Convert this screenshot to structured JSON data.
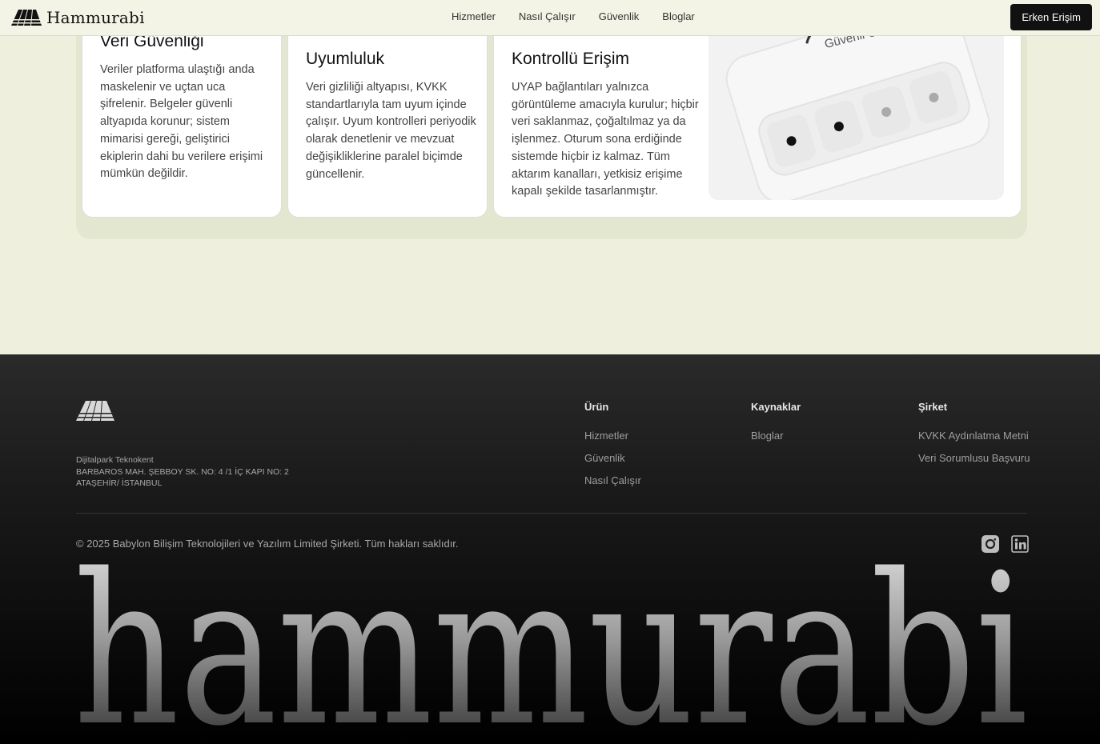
{
  "header": {
    "brand": "Hammurabi",
    "nav": [
      "Hizmetler",
      "Nasıl Çalışır",
      "Güvenlik",
      "Bloglar"
    ],
    "cta": "Erken Erişim"
  },
  "features": [
    {
      "title": "Veri Güvenliği",
      "body": "Veriler platforma ulaştığı anda maskelenir ve uçtan uca şifrelenir. Belgeler güvenli altyapıda korunur; sistem mimarisi gereği, geliştirici ekiplerin dahi bu verilere erişimi mümkün değildir."
    },
    {
      "title": "Uyumluluk",
      "body": "Veri gizliliği altyapısı, KVKK standartlarıyla tam uyum içinde çalışır. Uyum kontrolleri periyodik olarak denetlenir ve mevzuat değişikliklerine paralel biçimde güncellenir."
    },
    {
      "title": "Kontrollü Erişim",
      "body": "UYAP bağlantıları yalnızca görüntüleme amacıyla kurulur; hiçbir veri saklanmaz, çoğaltılmaz ya da işlenmez. Oturum sona erdiğinde sistemde hiçbir iz kalmaz. Tüm aktarım kanalları, yetkisiz erişime kapalı şekilde tasarlanmıştır."
    }
  ],
  "illustration": {
    "caption": "Güvenli Giriş"
  },
  "footer": {
    "address": {
      "line1": "Dijitalpark Teknokent",
      "line2": "BARBAROS MAH. ŞEBBOY SK. NO: 4 /1 İÇ KAPI NO: 2",
      "line3": "ATAŞEHİR/ İSTANBUL"
    },
    "columns": [
      {
        "title": "Ürün",
        "links": [
          "Hizmetler",
          "Güvenlik",
          "Nasıl Çalışır"
        ]
      },
      {
        "title": "Kaynaklar",
        "links": [
          "Bloglar"
        ]
      },
      {
        "title": "Şirket",
        "links": [
          "KVKK Aydınlatma Metni",
          "Veri Sorumlusu Başvuru"
        ]
      }
    ],
    "copyright": "© 2025 Babylon Bilişim Teknolojileri ve Yazılım Limited Şirketi. Tüm hakları saklıdır.",
    "social": [
      "instagram-icon",
      "linkedin-icon"
    ],
    "wordmark": "hammurabi"
  },
  "colors": {
    "background": "#efefdd",
    "footer": "#111111",
    "accent": "#111111"
  }
}
